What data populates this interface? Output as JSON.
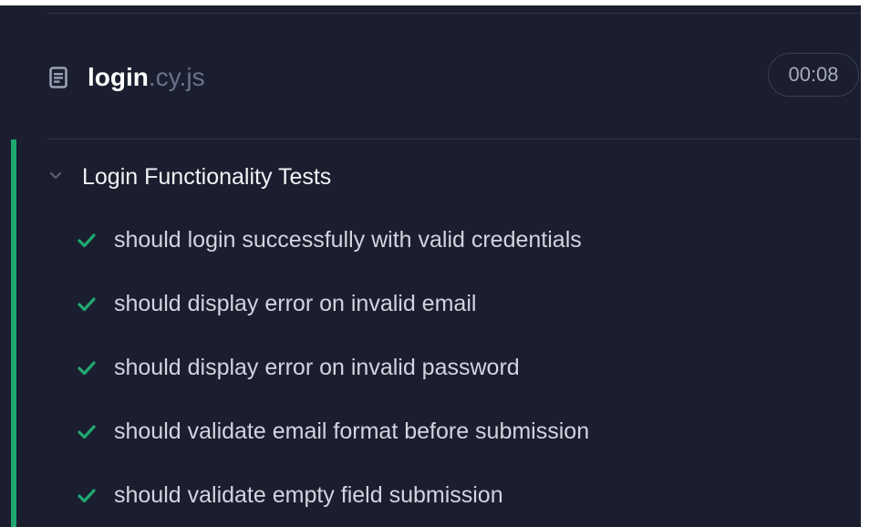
{
  "spec": {
    "file_base": "login",
    "file_ext": ".cy.js",
    "duration": "00:08",
    "icon": "document-icon"
  },
  "suite": {
    "title": "Login Functionality Tests",
    "icon": "chevron-down-icon"
  },
  "tests": [
    {
      "title": "should login successfully with valid credentials",
      "status": "passed"
    },
    {
      "title": "should display error on invalid email",
      "status": "passed"
    },
    {
      "title": "should display error on invalid password",
      "status": "passed"
    },
    {
      "title": "should validate email format before submission",
      "status": "passed"
    },
    {
      "title": "should validate empty field submission",
      "status": "passed"
    }
  ],
  "colors": {
    "background": "#1b1e2e",
    "passed": "#1fa971",
    "divider": "#2e3246",
    "text_primary": "#ffffff",
    "text_secondary": "#6c7189"
  }
}
